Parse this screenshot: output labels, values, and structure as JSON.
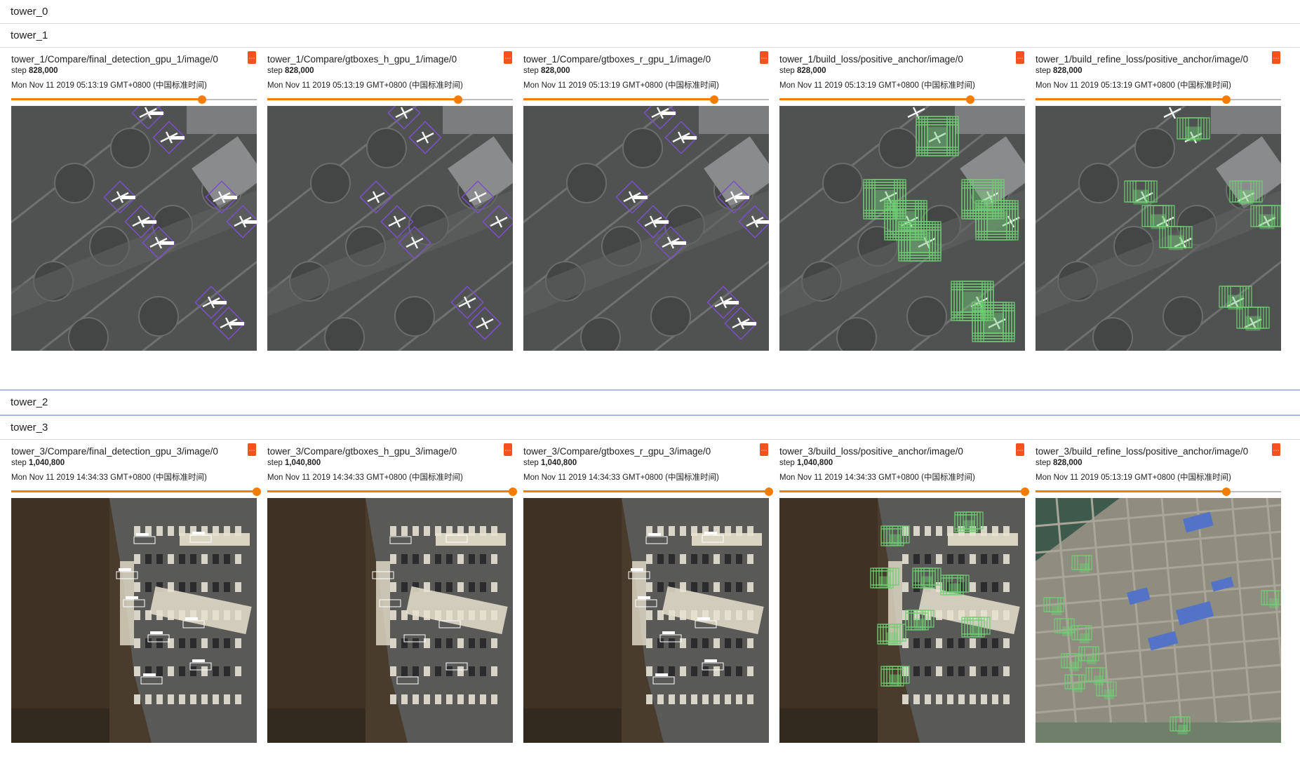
{
  "sections": [
    {
      "id": "tower_0",
      "label": "tower_0"
    },
    {
      "id": "tower_1",
      "label": "tower_1"
    },
    {
      "id": "tower_2",
      "label": "tower_2"
    },
    {
      "id": "tower_3",
      "label": "tower_3"
    }
  ],
  "tower_1": {
    "cards": [
      {
        "title": "tower_1/Compare/final_detection_gpu_1/image/0",
        "step_label": "step",
        "step": "828,000",
        "time": "Mon Nov 11 2019 05:13:19 GMT+0800 (中国标准时间)",
        "slider_fraction": 0.776
      },
      {
        "title": "tower_1/Compare/gtboxes_h_gpu_1/image/0",
        "step_label": "step",
        "step": "828,000",
        "time": "Mon Nov 11 2019 05:13:19 GMT+0800 (中国标准时间)",
        "slider_fraction": 0.776
      },
      {
        "title": "tower_1/Compare/gtboxes_r_gpu_1/image/0",
        "step_label": "step",
        "step": "828,000",
        "time": "Mon Nov 11 2019 05:13:19 GMT+0800 (中国标准时间)",
        "slider_fraction": 0.776
      },
      {
        "title": "tower_1/build_loss/positive_anchor/image/0",
        "step_label": "step",
        "step": "828,000",
        "time": "Mon Nov 11 2019 05:13:19 GMT+0800 (中国标准时间)",
        "slider_fraction": 0.776
      },
      {
        "title": "tower_1/build_refine_loss/positive_anchor/image/0",
        "step_label": "step",
        "step": "828,000",
        "time": "Mon Nov 11 2019 05:13:19 GMT+0800 (中国标准时间)",
        "slider_fraction": 0.776
      }
    ]
  },
  "tower_3": {
    "cards": [
      {
        "title": "tower_3/Compare/final_detection_gpu_3/image/0",
        "step_label": "step",
        "step": "1,040,800",
        "time": "Mon Nov 11 2019 14:34:33 GMT+0800 (中国标准时间)",
        "slider_fraction": 1.0
      },
      {
        "title": "tower_3/Compare/gtboxes_h_gpu_3/image/0",
        "step_label": "step",
        "step": "1,040,800",
        "time": "Mon Nov 11 2019 14:34:33 GMT+0800 (中国标准时间)",
        "slider_fraction": 1.0
      },
      {
        "title": "tower_3/Compare/gtboxes_r_gpu_3/image/0",
        "step_label": "step",
        "step": "1,040,800",
        "time": "Mon Nov 11 2019 14:34:33 GMT+0800 (中国标准时间)",
        "slider_fraction": 1.0
      },
      {
        "title": "tower_3/build_loss/positive_anchor/image/0",
        "step_label": "step",
        "step": "1,040,800",
        "time": "Mon Nov 11 2019 14:34:33 GMT+0800 (中国标准时间)",
        "slider_fraction": 1.0
      },
      {
        "title": "tower_3/build_refine_loss/positive_anchor/image/0",
        "step_label": "step",
        "step": "828,000",
        "time": "Mon Nov 11 2019 05:13:19 GMT+0800 (中国标准时间)",
        "slider_fraction": 0.776
      }
    ]
  },
  "colors": {
    "accent": "#f57c00",
    "button": "#f4511e",
    "box_purple": "#7b4fc9",
    "anchor_green": "#6fcf73",
    "active_border": "#aab9ee"
  },
  "icons": {
    "card_button": "menu-icon"
  }
}
